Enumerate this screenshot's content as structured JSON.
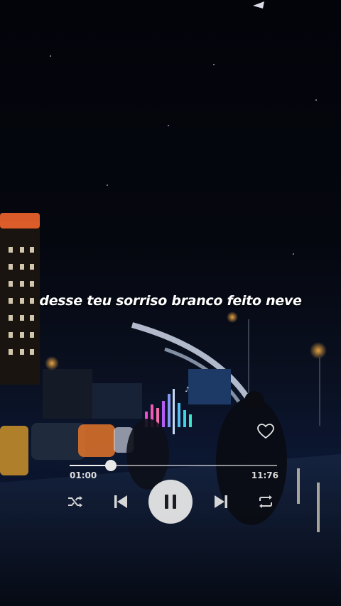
{
  "lyrics": {
    "current_line": "desse teu sorriso branco feito neve"
  },
  "player": {
    "elapsed": "01:00",
    "total": "11:76",
    "progress_fraction": 0.2,
    "is_playing": true,
    "liked": false,
    "accent_color": "#e8e8e8"
  },
  "icons": {
    "shuffle": "shuffle-icon",
    "previous": "skip-previous-icon",
    "play_pause": "pause-icon",
    "next": "skip-next-icon",
    "repeat": "repeat-icon",
    "favorite": "heart-outline-icon"
  }
}
